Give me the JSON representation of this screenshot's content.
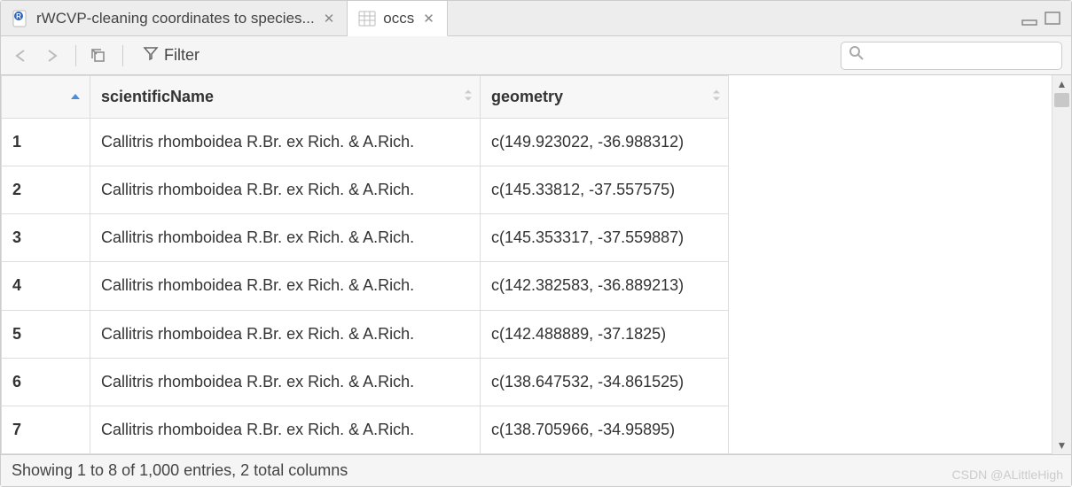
{
  "tabs": [
    {
      "label": "rWCVP-cleaning coordinates to species...",
      "icon": "r-script",
      "active": false
    },
    {
      "label": "occs",
      "icon": "data-table",
      "active": true
    }
  ],
  "toolbar": {
    "filter_label": "Filter",
    "search_placeholder": ""
  },
  "table": {
    "columns": [
      "scientificName",
      "geometry"
    ],
    "rows": [
      {
        "n": "1",
        "scientificName": "Callitris rhomboidea R.Br. ex Rich. & A.Rich.",
        "geometry": "c(149.923022, -36.988312)"
      },
      {
        "n": "2",
        "scientificName": "Callitris rhomboidea R.Br. ex Rich. & A.Rich.",
        "geometry": "c(145.33812, -37.557575)"
      },
      {
        "n": "3",
        "scientificName": "Callitris rhomboidea R.Br. ex Rich. & A.Rich.",
        "geometry": "c(145.353317, -37.559887)"
      },
      {
        "n": "4",
        "scientificName": "Callitris rhomboidea R.Br. ex Rich. & A.Rich.",
        "geometry": "c(142.382583, -36.889213)"
      },
      {
        "n": "5",
        "scientificName": "Callitris rhomboidea R.Br. ex Rich. & A.Rich.",
        "geometry": "c(142.488889, -37.1825)"
      },
      {
        "n": "6",
        "scientificName": "Callitris rhomboidea R.Br. ex Rich. & A.Rich.",
        "geometry": "c(138.647532, -34.861525)"
      },
      {
        "n": "7",
        "scientificName": "Callitris rhomboidea R.Br. ex Rich. & A.Rich.",
        "geometry": "c(138.705966, -34.95895)"
      }
    ]
  },
  "status": "Showing 1 to 8 of 1,000 entries, 2 total columns",
  "watermark": "CSDN @ALittleHigh"
}
